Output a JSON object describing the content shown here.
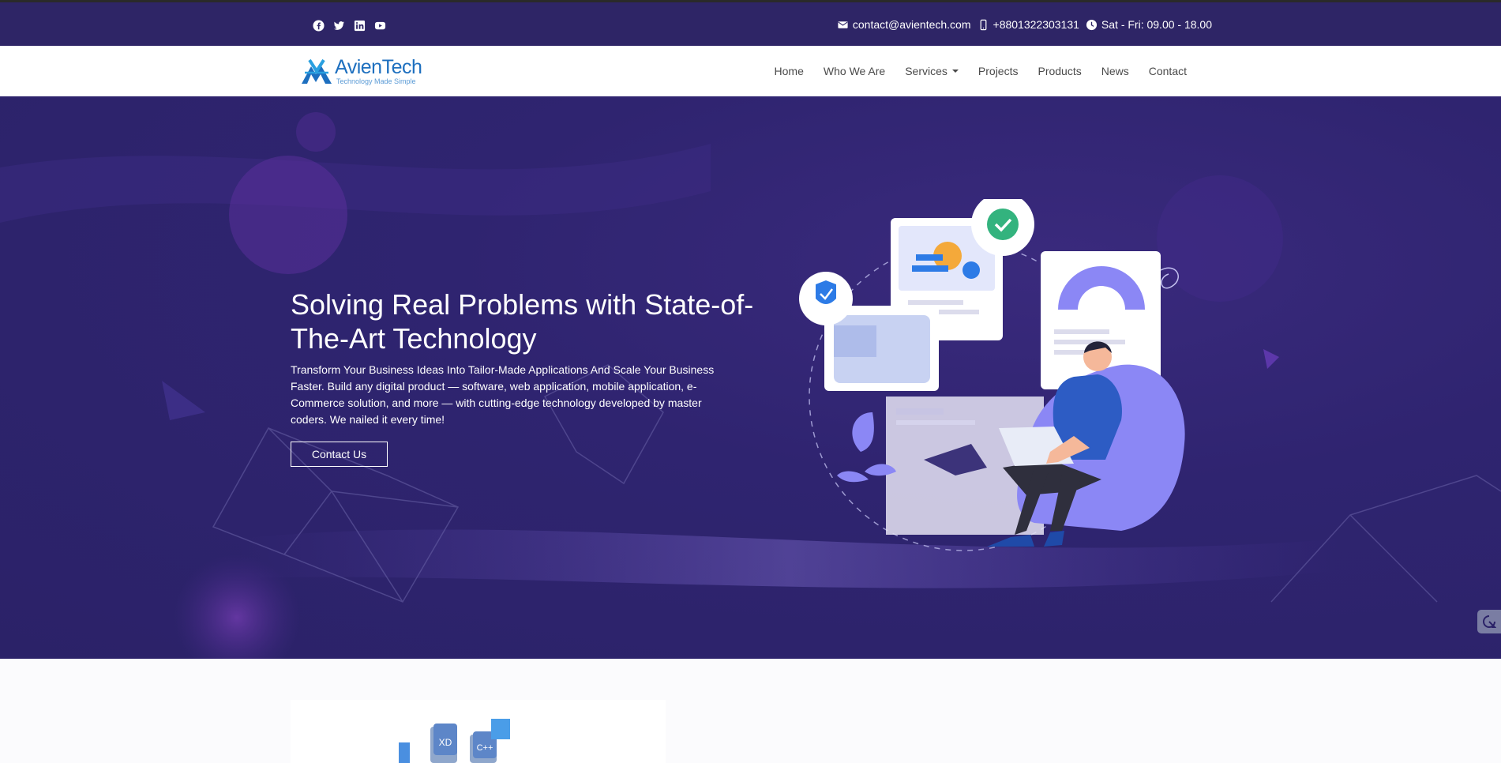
{
  "topbar": {
    "social_icons": [
      "facebook-icon",
      "twitter-icon",
      "linkedin-icon",
      "youtube-icon"
    ],
    "email": "contact@avientech.com",
    "phone": "+8801322303131",
    "hours": "Sat - Fri: 09.00 - 18.00"
  },
  "nav": {
    "logo": {
      "brand": "AvienTech",
      "tagline": "Technology Made Simple"
    },
    "items": [
      {
        "label": "Home"
      },
      {
        "label": "Who We Are"
      },
      {
        "label": "Services"
      },
      {
        "label": "Projects"
      },
      {
        "label": "Products"
      },
      {
        "label": "News"
      },
      {
        "label": "Contact"
      }
    ]
  },
  "hero": {
    "title": "Solving Real Problems with State-of-The-Art Technology",
    "description": "Transform Your Business Ideas Into Tailor-Made Applications And Scale Your Business Faster. Build any digital product — software, web application, mobile application, e-Commerce solution, and more — with cutting-edge technology developed by master coders. We nailed it every time!",
    "cta_label": "Contact Us"
  },
  "lower": {
    "icon_labels": [
      "XD",
      "C++"
    ]
  },
  "colors": {
    "topbar_bg": "#2e2566",
    "hero_bg": "#2b2268",
    "brand_blue": "#1d6fbf",
    "accent_purple": "#8b87f5"
  }
}
